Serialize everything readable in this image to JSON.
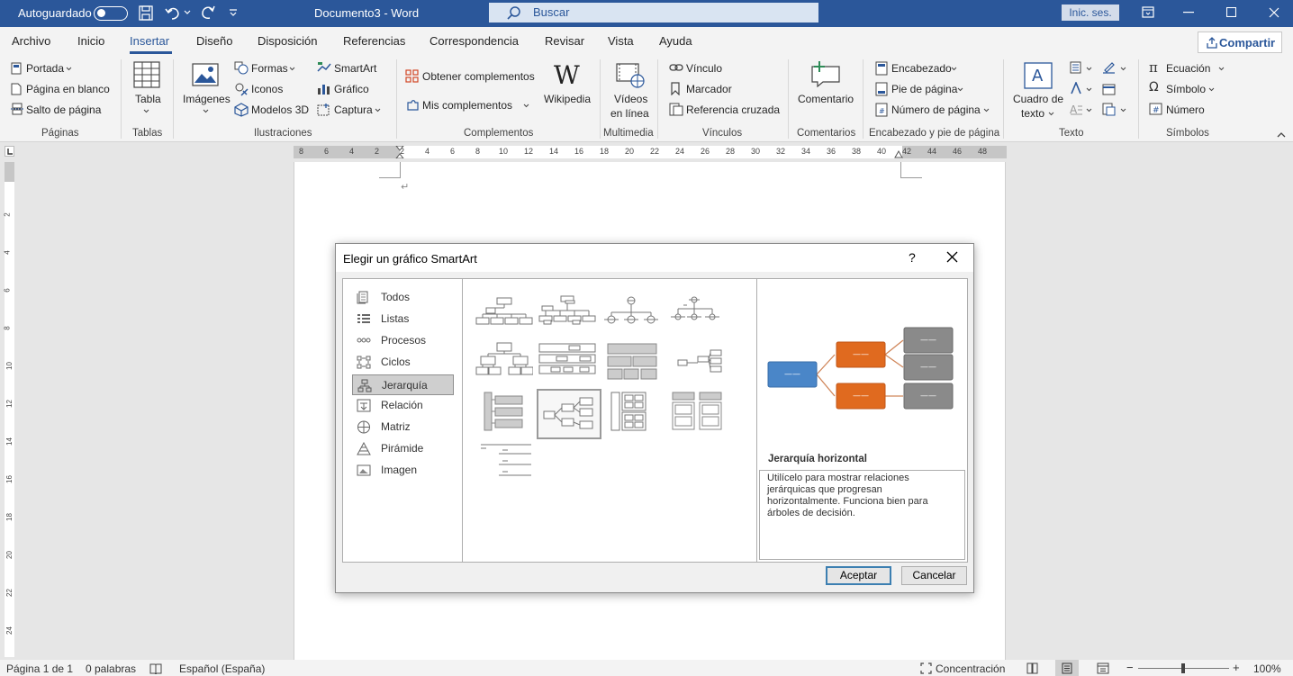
{
  "titlebar": {
    "autosave_label": "Autoguardado",
    "doc_title": "Documento3  -  Word",
    "search_placeholder": "Buscar",
    "signin_label": "Inic. ses."
  },
  "tabs": [
    "Archivo",
    "Inicio",
    "Insertar",
    "Diseño",
    "Disposición",
    "Referencias",
    "Correspondencia",
    "Revisar",
    "Vista",
    "Ayuda"
  ],
  "active_tab": "Insertar",
  "share_label": "Compartir",
  "ribbon": {
    "paginas": {
      "portada": "Portada",
      "pagina_blanco": "Página en blanco",
      "salto": "Salto de página",
      "label": "Páginas"
    },
    "tablas": {
      "tabla": "Tabla",
      "label": "Tablas"
    },
    "ilustraciones": {
      "imagenes": "Imágenes",
      "formas": "Formas",
      "iconos": "Iconos",
      "modelos3d": "Modelos 3D",
      "smartart": "SmartArt",
      "grafico": "Gráfico",
      "captura": "Captura",
      "label": "Ilustraciones"
    },
    "complementos": {
      "obtener": "Obtener complementos",
      "mis": "Mis complementos",
      "wikipedia": "Wikipedia",
      "label": "Complementos"
    },
    "multimedia": {
      "videos1": "Vídeos",
      "videos2": "en línea",
      "label": "Multimedia"
    },
    "vinculos": {
      "vinculo": "Vínculo",
      "marcador": "Marcador",
      "referencia": "Referencia cruzada",
      "label": "Vínculos"
    },
    "comentarios": {
      "comentario": "Comentario",
      "label": "Comentarios"
    },
    "encabezado": {
      "encabezado": "Encabezado",
      "pie": "Pie de página",
      "numero": "Número de página",
      "label": "Encabezado y pie de página"
    },
    "texto": {
      "cuadro1": "Cuadro de",
      "cuadro2": "texto",
      "label": "Texto"
    },
    "simbolos": {
      "ecuacion": "Ecuación",
      "simbolo": "Símbolo",
      "numero": "Número",
      "label": "Símbolos"
    }
  },
  "ruler": {
    "h_ticks": [
      "8",
      "6",
      "4",
      "2",
      "2",
      "4",
      "6",
      "8",
      "10",
      "12",
      "14",
      "16",
      "18",
      "20",
      "22",
      "24",
      "26",
      "28",
      "30",
      "32",
      "34",
      "36",
      "38",
      "40",
      "42",
      "44",
      "46",
      "48"
    ],
    "v_ticks": [
      "2",
      "4",
      "6",
      "8",
      "10",
      "12",
      "14",
      "16",
      "18",
      "20",
      "22",
      "24"
    ]
  },
  "document": {
    "paragraph_mark": "↵"
  },
  "dialog": {
    "title": "Elegir un gráfico SmartArt",
    "help": "?",
    "categories": [
      "Todos",
      "Listas",
      "Procesos",
      "Ciclos",
      "Jerarquía",
      "Relación",
      "Matriz",
      "Pirámide",
      "Imagen"
    ],
    "selected_category": "Jerarquía",
    "preview_name": "Jerarquía horizontal",
    "preview_description": "Utilícelo para mostrar relaciones jerárquicas que progresan horizontalmente. Funciona bien para árboles de decisión.",
    "preview_colors": {
      "root": "#4a86c8",
      "level2": "#e06a1f",
      "level3": "#8a8a8a"
    },
    "ok_label": "Aceptar",
    "cancel_label": "Cancelar"
  },
  "status": {
    "page": "Página 1 de 1",
    "words": "0 palabras",
    "language": "Español (España)",
    "focus": "Concentración",
    "zoom": "100%"
  },
  "colors": {
    "word_blue": "#2b579a"
  }
}
